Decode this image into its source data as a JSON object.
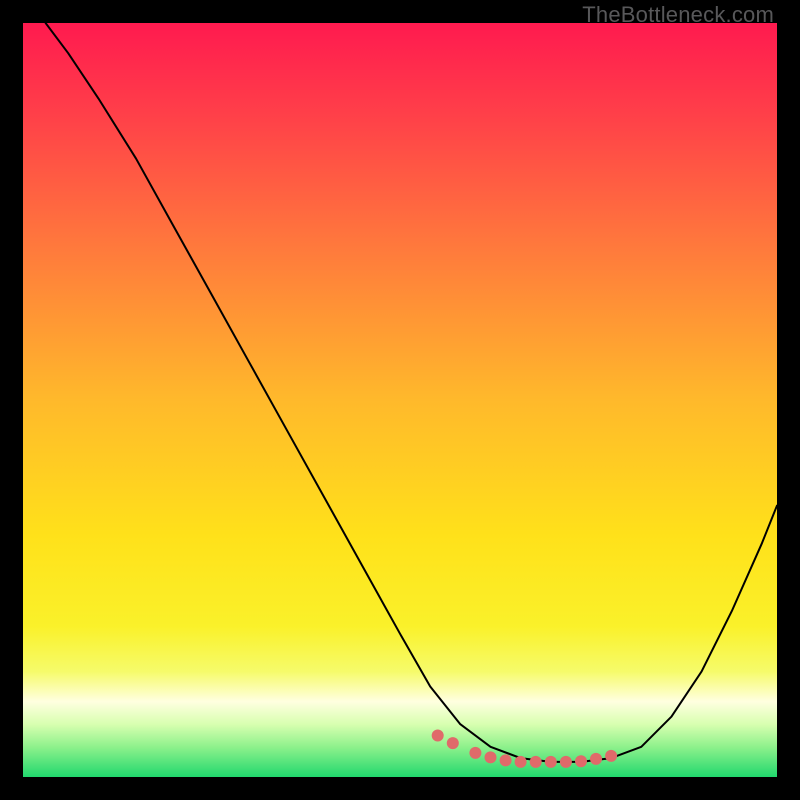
{
  "watermark": "TheBottleneck.com",
  "chart_data": {
    "type": "line",
    "title": "",
    "xlabel": "",
    "ylabel": "",
    "xlim": [
      0,
      100
    ],
    "ylim": [
      0,
      100
    ],
    "grid": false,
    "background_gradient": {
      "top_color": "#ff1a4f",
      "mid_color": "#ffd400",
      "bottom_white_band": "#ffffe0",
      "bottom_color": "#21d86e"
    },
    "series": [
      {
        "name": "bottleneck-curve",
        "color": "#000000",
        "stroke_width": 2,
        "x": [
          3,
          6,
          10,
          15,
          20,
          25,
          30,
          35,
          40,
          45,
          50,
          54,
          58,
          62,
          66,
          70,
          74,
          78,
          82,
          86,
          90,
          94,
          98,
          100
        ],
        "values": [
          100,
          96,
          90,
          82,
          73,
          64,
          55,
          46,
          37,
          28,
          19,
          12,
          7,
          4,
          2.5,
          2,
          2,
          2.5,
          4,
          8,
          14,
          22,
          31,
          36
        ]
      },
      {
        "name": "optimal-points",
        "type": "scatter",
        "color": "#e06a6a",
        "radius": 6,
        "x": [
          55,
          57,
          60,
          62,
          64,
          66,
          68,
          70,
          72,
          74,
          76,
          78
        ],
        "values": [
          5.5,
          4.5,
          3.2,
          2.6,
          2.2,
          2.0,
          2.0,
          2.0,
          2.0,
          2.1,
          2.4,
          2.8
        ]
      }
    ]
  }
}
